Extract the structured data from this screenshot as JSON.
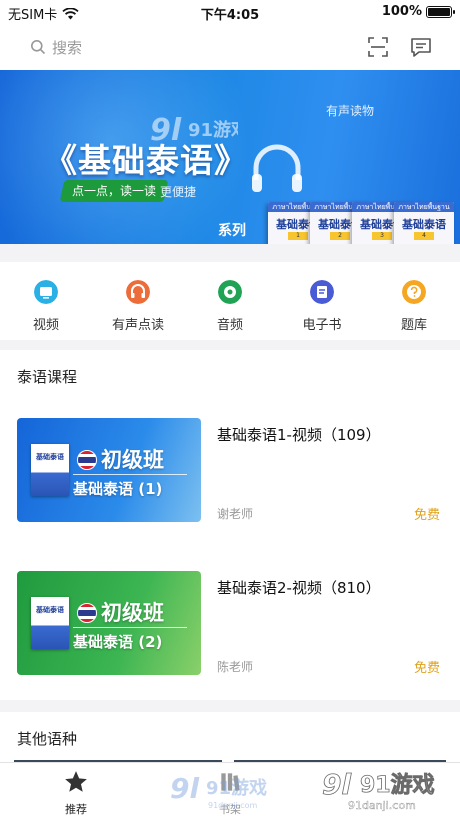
{
  "status_bar": {
    "carrier": "无SIM卡",
    "time": "下午4:05",
    "battery": "100%"
  },
  "search": {
    "placeholder": "搜索",
    "icons": [
      "search-icon",
      "scan-icon",
      "message-icon"
    ]
  },
  "banner": {
    "title": "《基础泰语》",
    "series": "系列",
    "tap_button": "点一点，读一读",
    "tagline": "更便捷",
    "audio_label": "有声读物",
    "book_title": "基础泰语",
    "book_header": "ภาษาไทยพื้นฐาน",
    "book_volumes": [
      "1",
      "2",
      "3",
      "4"
    ],
    "watermark": "91游戏"
  },
  "categories": [
    {
      "label": "视频",
      "icon": "video-icon",
      "color": "#2bb0e6"
    },
    {
      "label": "有声点读",
      "icon": "audio-read-icon",
      "color": "#ec6c3a"
    },
    {
      "label": "音频",
      "icon": "audio-icon",
      "color": "#21a355"
    },
    {
      "label": "电子书",
      "icon": "ebook-icon",
      "color": "#4a5bd6"
    },
    {
      "label": "题库",
      "icon": "question-bank-icon",
      "color": "#f5a623"
    }
  ],
  "courses_section": {
    "title": "泰语课程",
    "courses": [
      {
        "title": "基础泰语1-视频（109）",
        "teacher": "谢老师",
        "price": "免费",
        "thumb_level": "初级班",
        "thumb_book": "基础泰语 (1)",
        "thumb_color": "#1e7fe0"
      },
      {
        "title": "基础泰语2-视频（810）",
        "teacher": "陈老师",
        "price": "免费",
        "thumb_level": "初级班",
        "thumb_book": "基础泰语 (2)",
        "thumb_color": "#2aa846"
      }
    ]
  },
  "other_section": {
    "title": "其他语种"
  },
  "tab_bar": {
    "tabs": [
      {
        "label": "推荐",
        "icon": "star-icon",
        "active": true
      },
      {
        "label": "书架",
        "icon": "bookshelf-icon",
        "active": false
      }
    ]
  },
  "watermarks": {
    "logo": "91游戏",
    "url": "91danji.com"
  },
  "colors": {
    "accent": "#2f7fe8",
    "price": "#e0a21c",
    "background": "#f3f3f5"
  }
}
